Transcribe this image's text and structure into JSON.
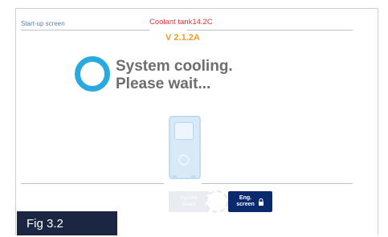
{
  "header": {
    "screen_title": "Start-up screen",
    "coolant_text": "Coolant tank14.2C",
    "version": "V 2.1.2A"
  },
  "status": {
    "line1": "System cooling.",
    "line2": "Please wait..."
  },
  "buttons": {
    "system_status_line1": "System",
    "system_status_line2": "status",
    "eng_screen_line1": "Eng.",
    "eng_screen_line2": "screen"
  },
  "figure": {
    "label": "Fig 3.2"
  },
  "colors": {
    "accent_blue": "#2aa8e0",
    "navy": "#0b2a6e",
    "orange": "#f39a1e",
    "red": "#e23333"
  }
}
